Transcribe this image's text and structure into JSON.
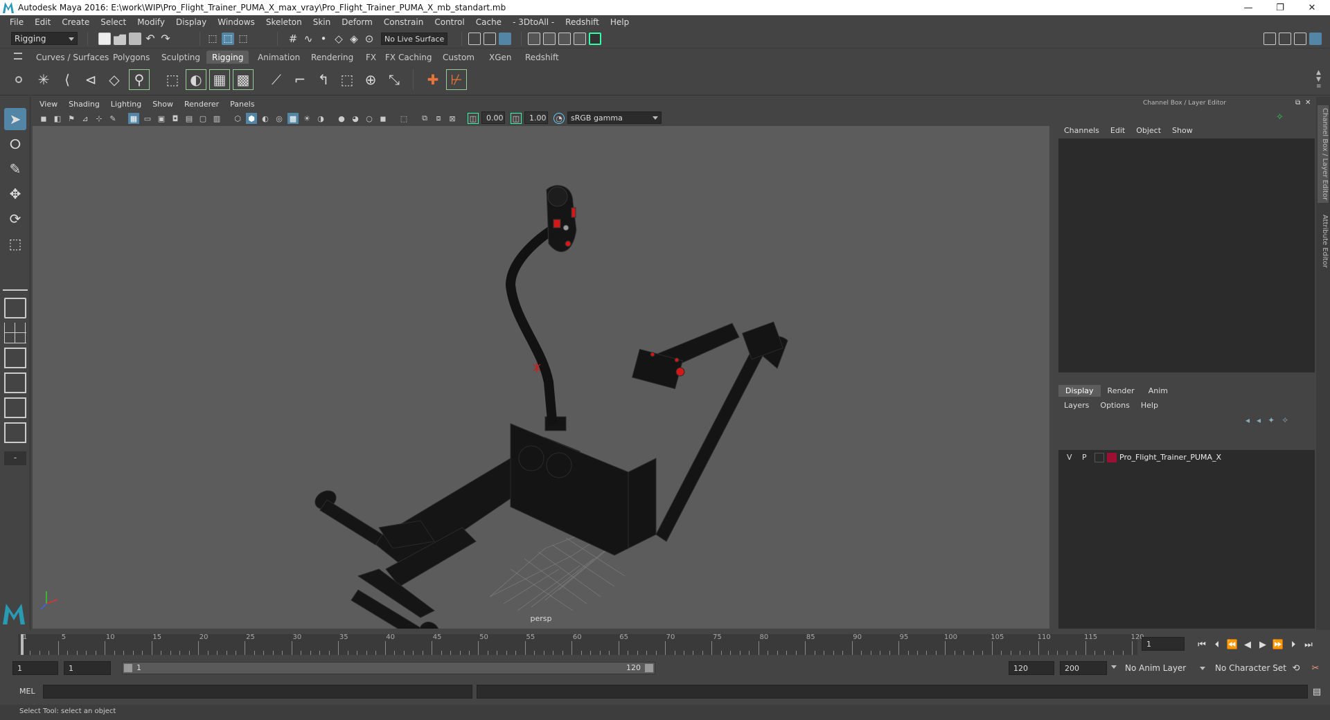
{
  "window": {
    "title": "Autodesk Maya 2016: E:\\work\\WIP\\Pro_Flight_Trainer_PUMA_X_max_vray\\Pro_Flight_Trainer_PUMA_X_mb_standart.mb",
    "controls": {
      "minimize": "—",
      "restore": "❐",
      "close": "✕"
    }
  },
  "menubar": [
    "File",
    "Edit",
    "Create",
    "Select",
    "Modify",
    "Display",
    "Windows",
    "Skeleton",
    "Skin",
    "Deform",
    "Constrain",
    "Control",
    "Cache",
    "- 3DtoAll -",
    "Redshift",
    "Help"
  ],
  "status_line": {
    "menu_set": "Rigging",
    "live_surface": "No Live Surface"
  },
  "shelf": {
    "tabs": [
      "Curves / Surfaces",
      "Polygons",
      "Sculpting",
      "Rigging",
      "Animation",
      "Rendering",
      "FX",
      "FX Caching",
      "Custom",
      "XGen",
      "Redshift"
    ],
    "active_tab": "Rigging"
  },
  "viewport": {
    "menu": [
      "View",
      "Shading",
      "Lighting",
      "Show",
      "Renderer",
      "Panels"
    ],
    "exposure": "0.00",
    "gamma": "1.00",
    "color_space": "sRGB gamma",
    "camera_label": "persp"
  },
  "channel_box": {
    "title": "Channel Box / Layer Editor",
    "menu": [
      "Channels",
      "Edit",
      "Object",
      "Show"
    ]
  },
  "layer_editor": {
    "tabs": [
      "Display",
      "Render",
      "Anim"
    ],
    "active_tab": "Display",
    "menu": [
      "Layers",
      "Options",
      "Help"
    ],
    "layers": [
      {
        "v": "V",
        "p": "P",
        "name": "Pro_Flight_Trainer_PUMA_X",
        "color": "#9b1030"
      }
    ]
  },
  "side_tabs": [
    "Channel Box / Layer Editor",
    "Attribute Editor"
  ],
  "timeline": {
    "ticks": [
      1,
      5,
      10,
      15,
      20,
      25,
      30,
      35,
      40,
      45,
      50,
      55,
      60,
      65,
      70,
      75,
      80,
      85,
      90,
      95,
      100,
      105,
      110,
      115,
      120
    ],
    "current_frame": "1"
  },
  "range": {
    "start": "1",
    "playback_start": "1",
    "slider_start": "1",
    "slider_end": "120",
    "playback_end": "120",
    "end": "200",
    "anim_layer": "No Anim Layer",
    "character_set": "No Character Set"
  },
  "command_line": {
    "label": "MEL"
  },
  "help_line": {
    "text": "Select Tool: select an object"
  },
  "colors": {
    "accent": "#5285a6",
    "layer_color": "#9b1030"
  }
}
